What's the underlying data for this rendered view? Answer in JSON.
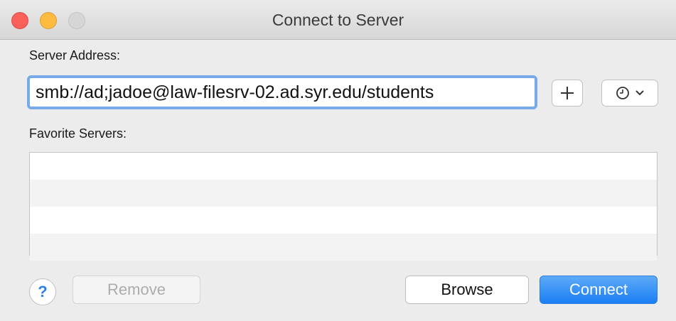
{
  "window": {
    "title": "Connect to Server"
  },
  "server_address": {
    "label": "Server Address:",
    "value": "smb://ad;jadoe@law-filesrv-02.ad.syr.edu/students"
  },
  "toolbar": {
    "add_icon": "plus-icon",
    "history_icon": "clock-icon"
  },
  "favorites": {
    "label": "Favorite Servers:",
    "rows": [
      "",
      "",
      "",
      ""
    ]
  },
  "buttons": {
    "help_label": "?",
    "remove_label": "Remove",
    "browse_label": "Browse",
    "connect_label": "Connect"
  },
  "colors": {
    "accent": "#1a7ef3",
    "focus_ring": "#78a9e8",
    "close": "#fc605b",
    "minimize": "#fdbc40",
    "zoom_disabled": "#d6d6d6"
  }
}
